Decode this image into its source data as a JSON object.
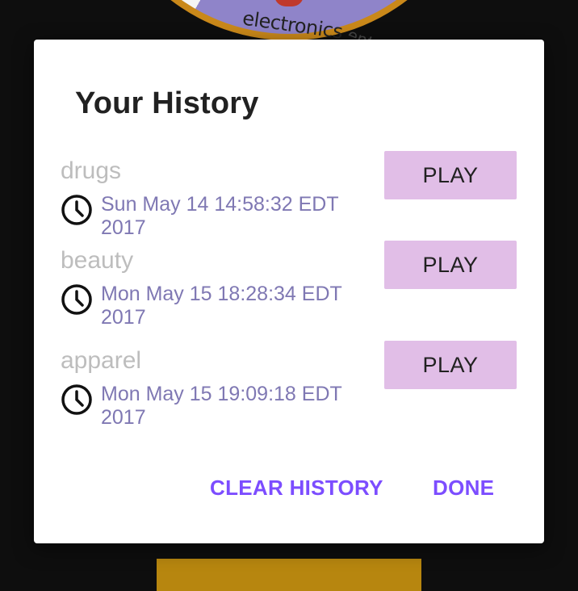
{
  "background": {
    "wheel_visible_labels": [
      "electronics",
      "ent"
    ],
    "colors": {
      "wheel_rim": "#c9881a",
      "wheel_segment_purple": "#8f84c9",
      "bottom_bar": "#b7860f"
    }
  },
  "dialog": {
    "title": "Your History",
    "items": [
      {
        "category": "drugs",
        "timestamp": "Sun May 14 14:58:32 EDT 2017",
        "play_label": "PLAY"
      },
      {
        "category": "beauty",
        "timestamp": "Mon May 15 18:28:34 EDT 2017",
        "play_label": "PLAY"
      },
      {
        "category": "apparel",
        "timestamp": "Mon May 15 19:09:18 EDT 2017",
        "play_label": "PLAY"
      }
    ],
    "actions": {
      "clear_label": "CLEAR HISTORY",
      "done_label": "DONE"
    },
    "icons": {
      "item_time": "clock-icon"
    },
    "colors": {
      "accent": "#7c4dff",
      "play_button_bg": "#e1bee7",
      "timestamp_text": "#7f78b3",
      "category_text": "#bdbdbd"
    }
  }
}
